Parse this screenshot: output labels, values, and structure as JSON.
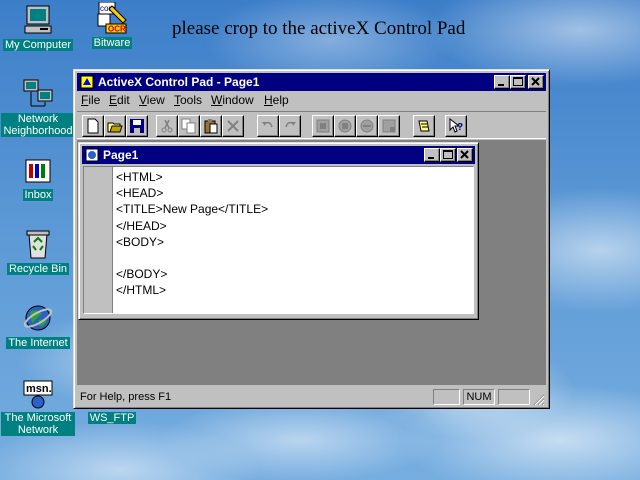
{
  "desktop": {
    "instruction": "please crop to the activeX Control Pad",
    "icons": [
      {
        "label": "My Computer",
        "icon": "my-computer-icon"
      },
      {
        "label": "Bitware",
        "icon": "bitware-icon"
      },
      {
        "label": "Network Neighborhood",
        "icon": "network-neighborhood-icon"
      },
      {
        "label": "Inbox",
        "icon": "inbox-icon"
      },
      {
        "label": "Recycle Bin",
        "icon": "recycle-bin-icon"
      },
      {
        "label": "The Internet",
        "icon": "internet-explorer-icon"
      },
      {
        "label": "The Microsoft Network",
        "icon": "msn-icon"
      },
      {
        "label": "WS_FTP",
        "icon": "ws-ftp-icon"
      }
    ],
    "icon_text_overlays": {
      "com": "com",
      "ocr": "OCR",
      "msn": "msn."
    },
    "colors": {
      "caption_bg": "#008080",
      "titlebar": "#000080",
      "face": "#c0c0c0"
    }
  },
  "app": {
    "title": "ActiveX Control Pad - Page1",
    "menu": [
      "File",
      "Edit",
      "View",
      "Tools",
      "Window",
      "Help"
    ],
    "menu_accel": [
      "F",
      "E",
      "V",
      "T",
      "W",
      "H"
    ],
    "menu_rest": [
      "ile",
      "dit",
      "iew",
      "ools",
      "indow",
      "elp"
    ],
    "toolbar": [
      "new-icon",
      "open-icon",
      "save-icon",
      "cut-icon",
      "copy-icon",
      "paste-icon",
      "delete-icon",
      "undo-icon",
      "redo-icon",
      "insert-control-icon",
      "edit-object-icon",
      "script-wizard-icon",
      "layout-icon",
      "edit-layout-icon",
      "help-icon"
    ],
    "child": {
      "title": "Page1",
      "code": "<HTML>\n<HEAD>\n<TITLE>New Page</TITLE>\n</HEAD>\n<BODY>\n\n</BODY>\n</HTML>"
    },
    "status": {
      "help": "For Help, press F1",
      "num": "NUM"
    }
  }
}
